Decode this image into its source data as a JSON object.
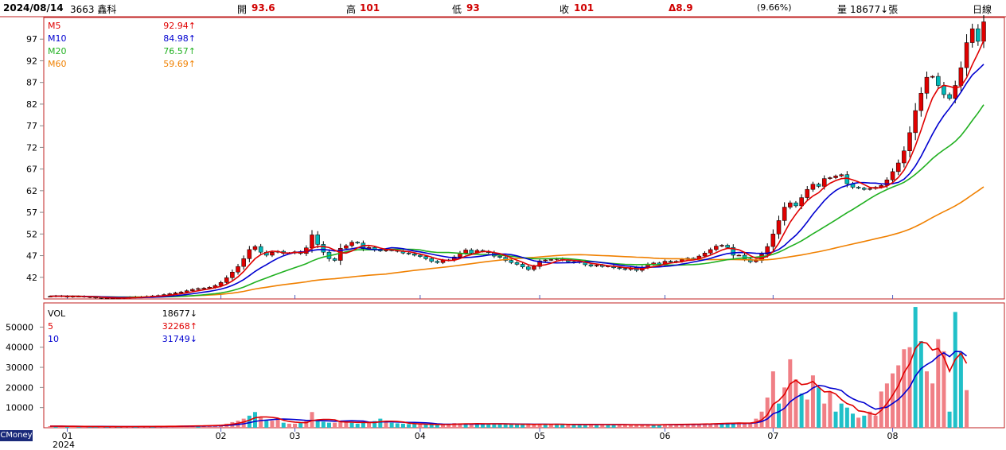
{
  "header": {
    "date": "2024/08/14",
    "stock": "3663 鑫科",
    "open_label": "開",
    "open": "93.6",
    "high_label": "高",
    "high": "101",
    "low_label": "低",
    "low": "93",
    "close_label": "收",
    "close": "101",
    "change": "Δ8.9",
    "change_pct": "(9.66%)",
    "volume_label": "量",
    "volume": "18677↓張",
    "period": "日線"
  },
  "brand": "CMoney",
  "colors": {
    "up": "#e00000",
    "down": "#00b8b8",
    "ma5": "#e00000",
    "ma10": "#0000d0",
    "ma20": "#20b020",
    "ma60": "#f08000",
    "vol_up": "#f07f85",
    "vol_down": "#20c0c8",
    "frame": "#c02020"
  },
  "chart_data": [
    {
      "type": "candlestick",
      "title": "3663 鑫科 日線",
      "ylim": [
        37,
        102
      ],
      "yticks": [
        42,
        47,
        52,
        57,
        62,
        67,
        72,
        77,
        82,
        87,
        92,
        97
      ],
      "x_ticks": [
        {
          "label": "01",
          "index": 3
        },
        {
          "label": "02",
          "index": 30
        },
        {
          "label": "03",
          "index": 43
        },
        {
          "label": "04",
          "index": 65
        },
        {
          "label": "05",
          "index": 86
        },
        {
          "label": "06",
          "index": 108
        },
        {
          "label": "07",
          "index": 127
        },
        {
          "label": "08",
          "index": 148
        }
      ],
      "year_label": "2024",
      "legend": [
        {
          "name": "M5",
          "value": "92.94↑",
          "color": "#e00000"
        },
        {
          "name": "M10",
          "value": "84.98↑",
          "color": "#0000d0"
        },
        {
          "name": "M20",
          "value": "76.57↑",
          "color": "#20b020"
        },
        {
          "name": "M60",
          "value": "59.69↑",
          "color": "#f08000"
        }
      ],
      "close": [
        37.6,
        37.7,
        37.6,
        37.5,
        37.6,
        37.6,
        37.5,
        37.4,
        37.3,
        37.2,
        37.2,
        37.2,
        37.2,
        37.3,
        37.4,
        37.5,
        37.5,
        37.6,
        37.7,
        37.8,
        38.0,
        38.2,
        38.4,
        38.6,
        38.9,
        39.2,
        39.4,
        39.5,
        39.7,
        40.1,
        40.8,
        41.9,
        43.2,
        44.5,
        46.3,
        48.4,
        49.1,
        47.8,
        47.1,
        47.8,
        48.0,
        47.5,
        47.6,
        47.9,
        47.5,
        48.8,
        51.8,
        49.6,
        47.8,
        46.3,
        45.9,
        48.7,
        49.3,
        50.1,
        49.9,
        48.6,
        48.9,
        48.3,
        48.1,
        48.3,
        48.2,
        48.0,
        47.6,
        47.4,
        47.1,
        46.8,
        46.3,
        45.7,
        45.4,
        45.9,
        46.0,
        46.7,
        47.6,
        48.3,
        47.6,
        48.2,
        48.0,
        47.7,
        46.9,
        46.6,
        45.9,
        45.4,
        45.0,
        44.4,
        43.8,
        44.5,
        45.8,
        46.0,
        46.1,
        46.3,
        46.0,
        45.6,
        45.4,
        45.6,
        44.9,
        44.6,
        44.8,
        44.5,
        44.6,
        44.2,
        44.0,
        43.8,
        44.2,
        43.6,
        44.3,
        45.0,
        45.3,
        45.0,
        45.7,
        45.5,
        45.7,
        46.1,
        46.4,
        46.3,
        46.9,
        47.6,
        48.4,
        49.2,
        49.4,
        48.9,
        47.1,
        47.1,
        46.2,
        45.6,
        45.9,
        47.3,
        49.1,
        52.0,
        55.1,
        58.2,
        59.2,
        58.5,
        60.4,
        62.3,
        63.5,
        63.0,
        64.8,
        65.0,
        65.4,
        65.7,
        63.6,
        62.8,
        62.6,
        62.3,
        62.5,
        62.8,
        63.2,
        64.5,
        66.4,
        68.4,
        71.2,
        75.4,
        80.5,
        84.5,
        88.2,
        88.4,
        86.3,
        84.2,
        83.3,
        86.3,
        90.4,
        96.2,
        99.4,
        96.5,
        101.0
      ],
      "volume": [
        800,
        700,
        700,
        600,
        700,
        650,
        650,
        600,
        600,
        550,
        550,
        550,
        600,
        600,
        600,
        650,
        650,
        650,
        700,
        700,
        700,
        750,
        800,
        850,
        900,
        950,
        1000,
        1100,
        1200,
        1300,
        1500,
        2000,
        2800,
        3500,
        4500,
        6000,
        7800,
        5000,
        3500,
        3500,
        4000,
        2500,
        2000,
        2000,
        2500,
        3500,
        7800,
        4000,
        3000,
        2500,
        2500,
        3000,
        3300,
        2500,
        2000,
        2500,
        2800,
        3300,
        4500,
        3000,
        2500,
        2200,
        2000,
        1800,
        1800,
        1700,
        1600,
        1500,
        1500,
        1600,
        1600,
        2300,
        2200,
        1900,
        1800,
        2100,
        2000,
        1900,
        1900,
        1800,
        1800,
        1700,
        1700,
        1600,
        1600,
        1700,
        1800,
        1700,
        1700,
        1700,
        1600,
        1500,
        1600,
        1500,
        1500,
        1600,
        1600,
        1600,
        1500,
        1500,
        1500,
        1500,
        1400,
        1400,
        1400,
        1500,
        1500,
        1600,
        1600,
        1600,
        1700,
        1800,
        1700,
        1800,
        1900,
        2000,
        2100,
        2200,
        2300,
        2400,
        2200,
        2600,
        2000,
        2500,
        4500,
        8000,
        15000,
        28000,
        12000,
        20000,
        34000,
        24000,
        17000,
        14000,
        26000,
        20000,
        12000,
        18000,
        8000,
        12000,
        10000,
        7000,
        5000,
        6000,
        8000,
        6000,
        18000,
        22000,
        27000,
        31000,
        39000,
        40000,
        60000,
        43000,
        28000,
        22000,
        44000,
        38000,
        8000,
        57500,
        37500,
        18677
      ],
      "vol_up": [
        1,
        0,
        1,
        0,
        1,
        0,
        1,
        0,
        0,
        1,
        0,
        1,
        0,
        1,
        1,
        0,
        1,
        1,
        0,
        1,
        1,
        1,
        1,
        1,
        1,
        1,
        0,
        1,
        1,
        1,
        1,
        1,
        1,
        1,
        1,
        0,
        0,
        1,
        0,
        1,
        1,
        0,
        1,
        1,
        0,
        1,
        1,
        0,
        0,
        0,
        1,
        1,
        1,
        0,
        0,
        0,
        1,
        0,
        0,
        1,
        0,
        0,
        0,
        0,
        0,
        1,
        0,
        0,
        0,
        1,
        1,
        1,
        1,
        0,
        1,
        0,
        0,
        0,
        0,
        0,
        0,
        0,
        0,
        0,
        1,
        1,
        1,
        0,
        1,
        0,
        0,
        1,
        0,
        0,
        0,
        1,
        0,
        1,
        0,
        0,
        1,
        1,
        1,
        1,
        1,
        1,
        0,
        0,
        1,
        1,
        1,
        1,
        1,
        1,
        1,
        1,
        1,
        1,
        0,
        0,
        0,
        1,
        1,
        1,
        1,
        1,
        1,
        1,
        0,
        1,
        1,
        1,
        0,
        1,
        1,
        0,
        1,
        1,
        0,
        0,
        0,
        0,
        1,
        0,
        1,
        1,
        1,
        1,
        1,
        1,
        1,
        1,
        0,
        0,
        1,
        1,
        1,
        1,
        0,
        0,
        0,
        1,
        1,
        0,
        1,
        1,
        0
      ]
    },
    {
      "type": "bar",
      "title": "VOL",
      "ylim": [
        0,
        62000
      ],
      "yticks": [
        10000,
        20000,
        30000,
        40000,
        50000
      ],
      "legend": [
        {
          "name": "VOL",
          "value": "18677↓",
          "color": "#000000"
        },
        {
          "name": "5",
          "value": "32268↑",
          "color": "#e00000"
        },
        {
          "name": "10",
          "value": "31749↓",
          "color": "#0000d0"
        }
      ]
    }
  ]
}
